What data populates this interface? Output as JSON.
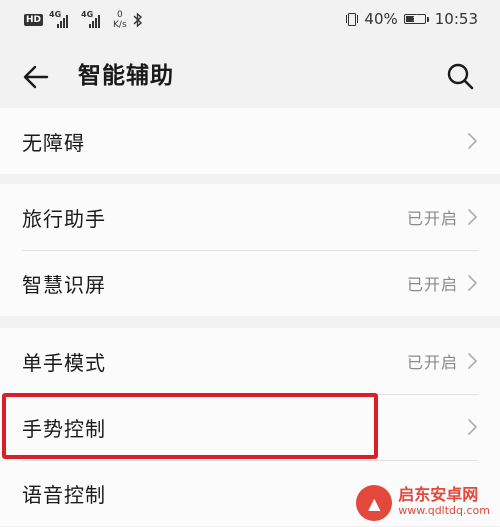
{
  "status_bar": {
    "hd": "HD",
    "sim1_net": "4G",
    "sim2_net": "4G",
    "speed_value": "0",
    "speed_unit": "K/s",
    "battery_percent": "40%",
    "time": "10:53",
    "icons": [
      "vibrate-icon",
      "battery-charging-icon",
      "bluetooth-icon",
      "signal-icon"
    ]
  },
  "app_bar": {
    "title": "智能辅助"
  },
  "groups": [
    {
      "items": [
        {
          "label": "无障碍",
          "status": ""
        }
      ]
    },
    {
      "items": [
        {
          "label": "旅行助手",
          "status": "已开启"
        },
        {
          "label": "智慧识屏",
          "status": "已开启"
        }
      ]
    },
    {
      "items": [
        {
          "label": "单手模式",
          "status": "已开启"
        },
        {
          "label": "手势控制",
          "status": ""
        },
        {
          "label": "语音控制",
          "status": ""
        }
      ]
    }
  ],
  "colors": {
    "highlight": "#d9202a",
    "status_text": "#8a8a8a",
    "background": "#f2f2f2"
  },
  "watermark": {
    "name": "启东安卓网",
    "url": "www.qdltdq.com"
  }
}
